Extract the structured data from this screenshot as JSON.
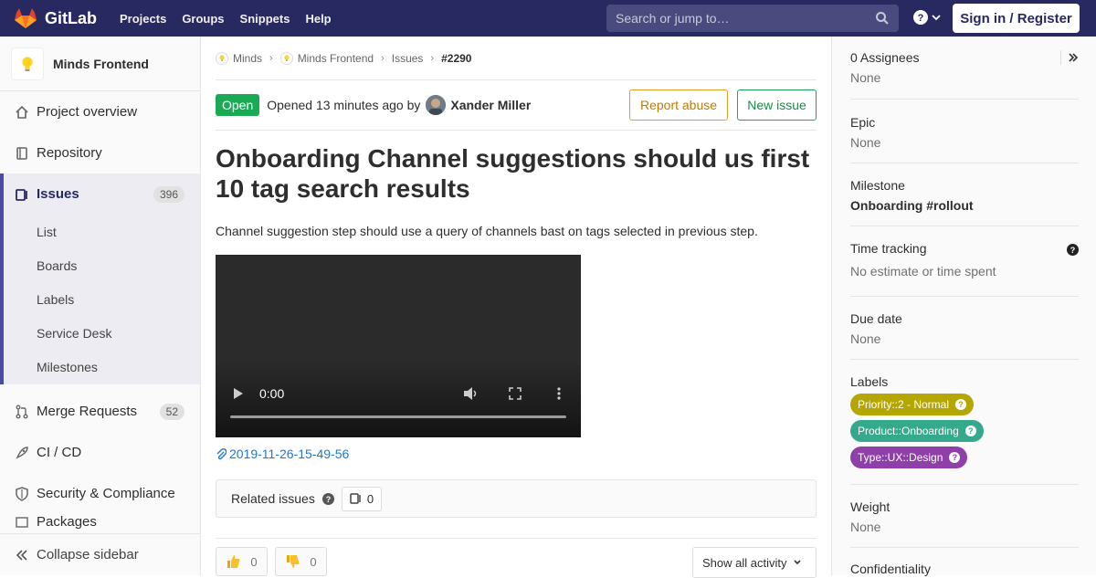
{
  "topbar": {
    "brand": "GitLab",
    "nav": [
      "Projects",
      "Groups",
      "Snippets",
      "Help"
    ],
    "search_placeholder": "Search or jump to…",
    "signin_label": "Sign in / Register"
  },
  "sidebar": {
    "project_name": "Minds Frontend",
    "items": [
      {
        "label": "Project overview",
        "icon": "home-icon"
      },
      {
        "label": "Repository",
        "icon": "book-icon"
      },
      {
        "label": "Issues",
        "icon": "issues-icon",
        "count": "396"
      },
      {
        "label": "Merge Requests",
        "icon": "merge-request-icon",
        "count": "52"
      },
      {
        "label": "CI / CD",
        "icon": "rocket-icon"
      },
      {
        "label": "Security & Compliance",
        "icon": "shield-icon"
      },
      {
        "label": "Packages",
        "icon": "package-icon"
      }
    ],
    "sub_items": [
      "List",
      "Boards",
      "Labels",
      "Service Desk",
      "Milestones"
    ],
    "collapse_label": "Collapse sidebar"
  },
  "breadcrumb": [
    "Minds",
    "Minds Frontend",
    "Issues",
    "#2290"
  ],
  "issue": {
    "status": "Open",
    "opened_text": "Opened 13 minutes ago by",
    "author": "Xander Miller",
    "report_abuse_label": "Report abuse",
    "new_issue_label": "New issue",
    "title": "Onboarding Channel suggestions should us first 10 tag search results",
    "description": "Channel suggestion step should use a query of channels bast on tags selected in previous step.",
    "video_time": "0:00",
    "attachment": "2019-11-26-15-49-56",
    "related_label": "Related issues",
    "related_count": "0",
    "thumbs_up_count": "0",
    "thumbs_down_count": "0",
    "activity_filter": "Show all activity"
  },
  "right_sidebar": {
    "assignees_title": "0 Assignees",
    "assignees_value": "None",
    "epic_title": "Epic",
    "epic_value": "None",
    "milestone_title": "Milestone",
    "milestone_value": "Onboarding #rollout",
    "time_title": "Time tracking",
    "time_value": "No estimate or time spent",
    "due_title": "Due date",
    "due_value": "None",
    "labels_title": "Labels",
    "labels": [
      {
        "text": "Priority::2 - Normal",
        "color": "#b5a602"
      },
      {
        "text": "Product::Onboarding",
        "color": "#34a98c"
      },
      {
        "text": "Type::UX::Design",
        "color": "#8e3fa8"
      }
    ],
    "weight_title": "Weight",
    "weight_value": "None",
    "confidentiality_title": "Confidentiality"
  },
  "colors": {
    "nav_bg": "#292961",
    "open_status": "#1aaa55",
    "link": "#1f78d1",
    "sidebar_active": "#4b4ba3"
  }
}
